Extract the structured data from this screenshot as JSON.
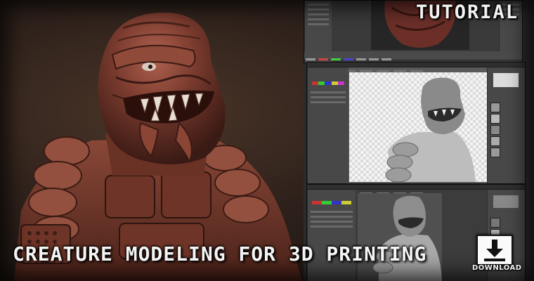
{
  "banner": {
    "tutorial_label": "TUTORIAL",
    "title": "CREATURE MODELING FOR 3D PRINTING",
    "download_label": "DOWNLOAD"
  },
  "icons": {
    "download": "download-arrow-icon"
  },
  "colors": {
    "creature": "#7a3b2e",
    "background": "#2e211b",
    "ui_dark": "#3a3a3a",
    "text": "#f4f4f4"
  }
}
